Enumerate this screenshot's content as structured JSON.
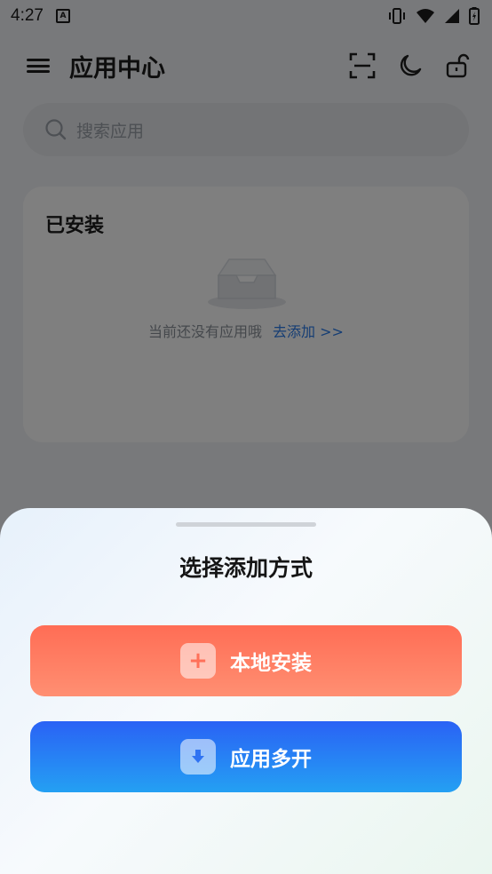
{
  "status_bar": {
    "time": "4:27",
    "notif_letter": "A"
  },
  "header": {
    "title": "应用中心"
  },
  "search": {
    "placeholder": "搜索应用"
  },
  "installed": {
    "title": "已安装",
    "empty_text": "当前还没有应用哦",
    "add_link": "去添加 >>"
  },
  "sheet": {
    "title": "选择添加方式",
    "options": [
      {
        "label": "本地安装",
        "icon": "plus-icon"
      },
      {
        "label": "应用多开",
        "icon": "download-icon"
      }
    ]
  },
  "colors": {
    "local_button": "#ff7a5f",
    "multi_button": "#2a6df4",
    "link": "#2a7be8"
  }
}
